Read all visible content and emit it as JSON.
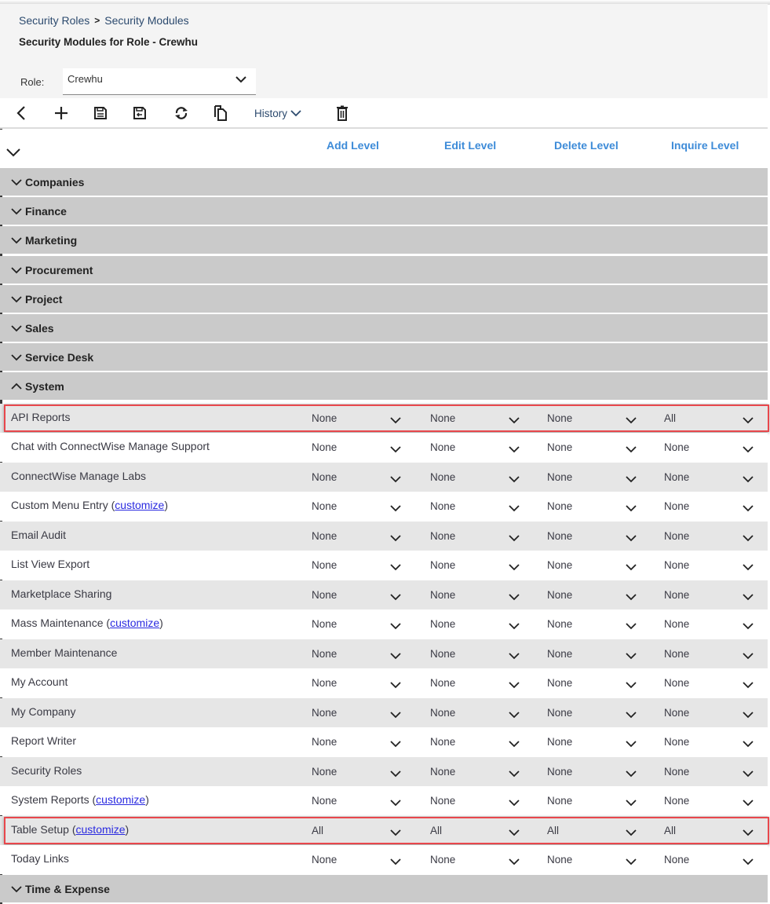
{
  "breadcrumb": {
    "items": [
      "Security Roles",
      "Security Modules"
    ],
    "separator": ">"
  },
  "page_title": "Security Modules for Role - Crewhu",
  "role": {
    "label": "Role:",
    "value": "Crewhu"
  },
  "toolbar": {
    "back_icon": "chevron-left-icon",
    "add_icon": "plus-icon",
    "save_icon": "floppy-disk-icon",
    "save_close_icon": "floppy-disk-arrow-icon",
    "refresh_icon": "refresh-icon",
    "copy_icon": "copy-icon",
    "history_label": "History",
    "delete_icon": "trash-icon"
  },
  "columns": [
    "Add Level",
    "Edit Level",
    "Delete Level",
    "Inquire Level"
  ],
  "sections_collapsed": [
    "Companies",
    "Finance",
    "Marketing",
    "Procurement",
    "Project",
    "Sales",
    "Service Desk"
  ],
  "expanded_section": "System",
  "rows": [
    {
      "name": "API Reports",
      "customize": "",
      "levels": [
        "None",
        "None",
        "None",
        "All"
      ],
      "highlighted": true
    },
    {
      "name": "Chat with ConnectWise Manage Support",
      "customize": "",
      "levels": [
        "None",
        "None",
        "None",
        "None"
      ]
    },
    {
      "name": "ConnectWise Manage Labs",
      "customize": "",
      "levels": [
        "None",
        "None",
        "None",
        "None"
      ]
    },
    {
      "name": "Custom Menu Entry",
      "customize": "customize",
      "levels": [
        "None",
        "None",
        "None",
        "None"
      ]
    },
    {
      "name": "Email Audit",
      "customize": "",
      "levels": [
        "None",
        "None",
        "None",
        "None"
      ]
    },
    {
      "name": "List View Export",
      "customize": "",
      "levels": [
        "None",
        "None",
        "None",
        "None"
      ]
    },
    {
      "name": "Marketplace Sharing",
      "customize": "",
      "levels": [
        "None",
        "None",
        "None",
        "None"
      ]
    },
    {
      "name": "Mass Maintenance",
      "customize": "customize",
      "levels": [
        "None",
        "None",
        "None",
        "None"
      ]
    },
    {
      "name": "Member Maintenance",
      "customize": "",
      "levels": [
        "None",
        "None",
        "None",
        "None"
      ]
    },
    {
      "name": "My Account",
      "customize": "",
      "levels": [
        "None",
        "None",
        "None",
        "None"
      ]
    },
    {
      "name": "My Company",
      "customize": "",
      "levels": [
        "None",
        "None",
        "None",
        "None"
      ]
    },
    {
      "name": "Report Writer",
      "customize": "",
      "levels": [
        "None",
        "None",
        "None",
        "None"
      ]
    },
    {
      "name": "Security Roles",
      "customize": "",
      "levels": [
        "None",
        "None",
        "None",
        "None"
      ]
    },
    {
      "name": "System Reports",
      "customize": "customize",
      "levels": [
        "None",
        "None",
        "None",
        "None"
      ]
    },
    {
      "name": "Table Setup",
      "customize": "customize",
      "levels": [
        "All",
        "All",
        "All",
        "All"
      ],
      "highlighted": true
    },
    {
      "name": "Today Links",
      "customize": "",
      "levels": [
        "None",
        "None",
        "None",
        "None"
      ]
    }
  ],
  "trailing_section": "Time & Expense",
  "colors": {
    "highlight_border": "#e8474c",
    "link": "#3d8bd8",
    "section_bg": "#cacaca",
    "row_alt": "#e6e6e6"
  }
}
